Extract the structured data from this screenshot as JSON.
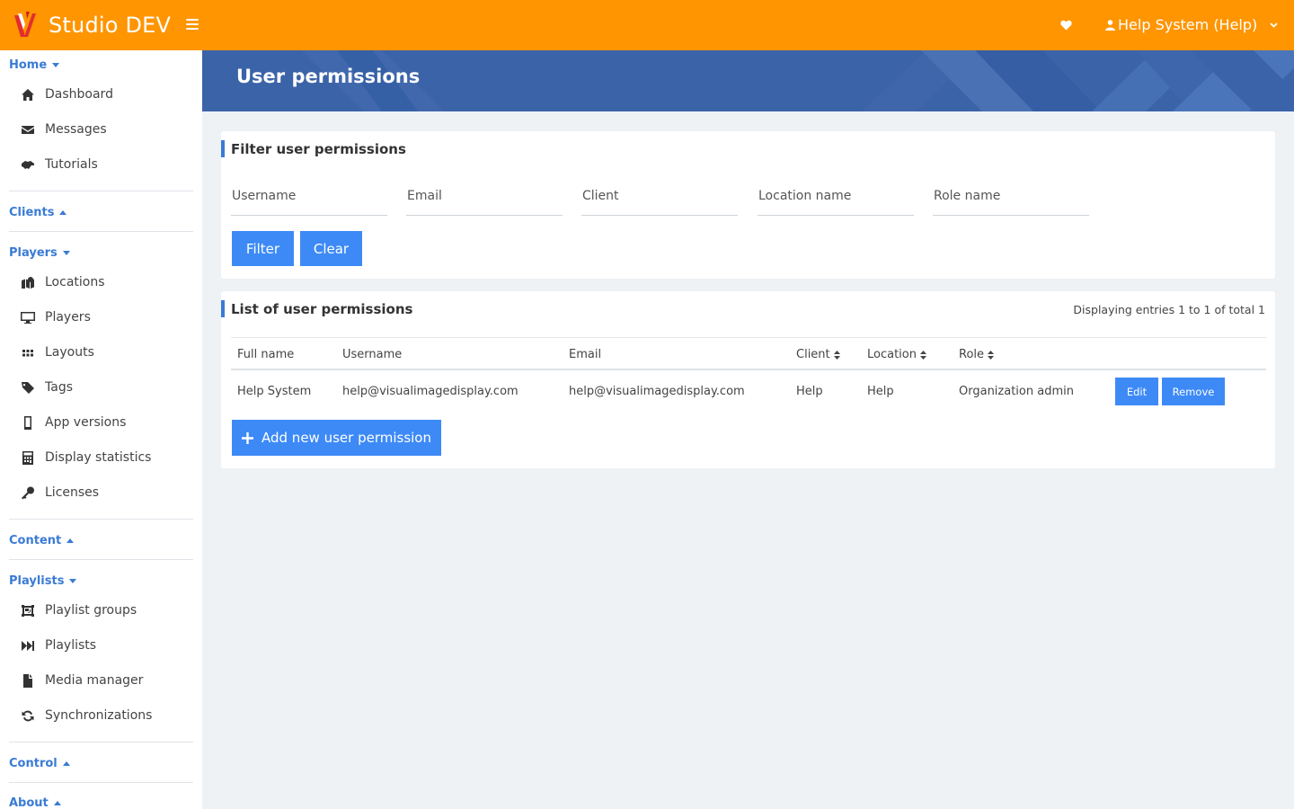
{
  "app": {
    "title": "Studio DEV"
  },
  "header": {
    "user_label": "Help System (Help)"
  },
  "sidebar": {
    "sections": [
      {
        "label": "Home",
        "items": [
          "Dashboard",
          "Messages",
          "Tutorials"
        ]
      },
      {
        "label": "Clients",
        "items": []
      },
      {
        "label": "Players",
        "items": [
          "Locations",
          "Players",
          "Layouts",
          "Tags",
          "App versions",
          "Display statistics",
          "Licenses"
        ]
      },
      {
        "label": "Content",
        "items": []
      },
      {
        "label": "Playlists",
        "items": [
          "Playlist groups",
          "Playlists",
          "Media manager",
          "Synchronizations"
        ]
      },
      {
        "label": "Control",
        "items": []
      },
      {
        "label": "About",
        "items": []
      }
    ]
  },
  "page": {
    "title": "User permissions"
  },
  "filter": {
    "title": "Filter user permissions",
    "fields": [
      {
        "placeholder": "Username",
        "value": ""
      },
      {
        "placeholder": "Email",
        "value": ""
      },
      {
        "placeholder": "Client",
        "value": ""
      },
      {
        "placeholder": "Location name",
        "value": ""
      },
      {
        "placeholder": "Role name",
        "value": ""
      }
    ],
    "filter_label": "Filter",
    "clear_label": "Clear"
  },
  "list": {
    "title": "List of user permissions",
    "count_text": "Displaying entries 1 to 1 of total 1",
    "columns": [
      "Full name",
      "Username",
      "Email",
      "Client",
      "Location",
      "Role"
    ],
    "rows": [
      {
        "full_name": "Help System",
        "username": "help@visualimagedisplay.com",
        "email": "help@visualimagedisplay.com",
        "client": "Help",
        "location": "Help",
        "role": "Organization admin"
      }
    ],
    "edit_label": "Edit",
    "remove_label": "Remove",
    "add_label": "Add new user permission"
  },
  "colors": {
    "topbar": "#ff9500",
    "accent": "#3a7bd5",
    "button": "#3d8af7",
    "banner": "#3b63a8"
  }
}
